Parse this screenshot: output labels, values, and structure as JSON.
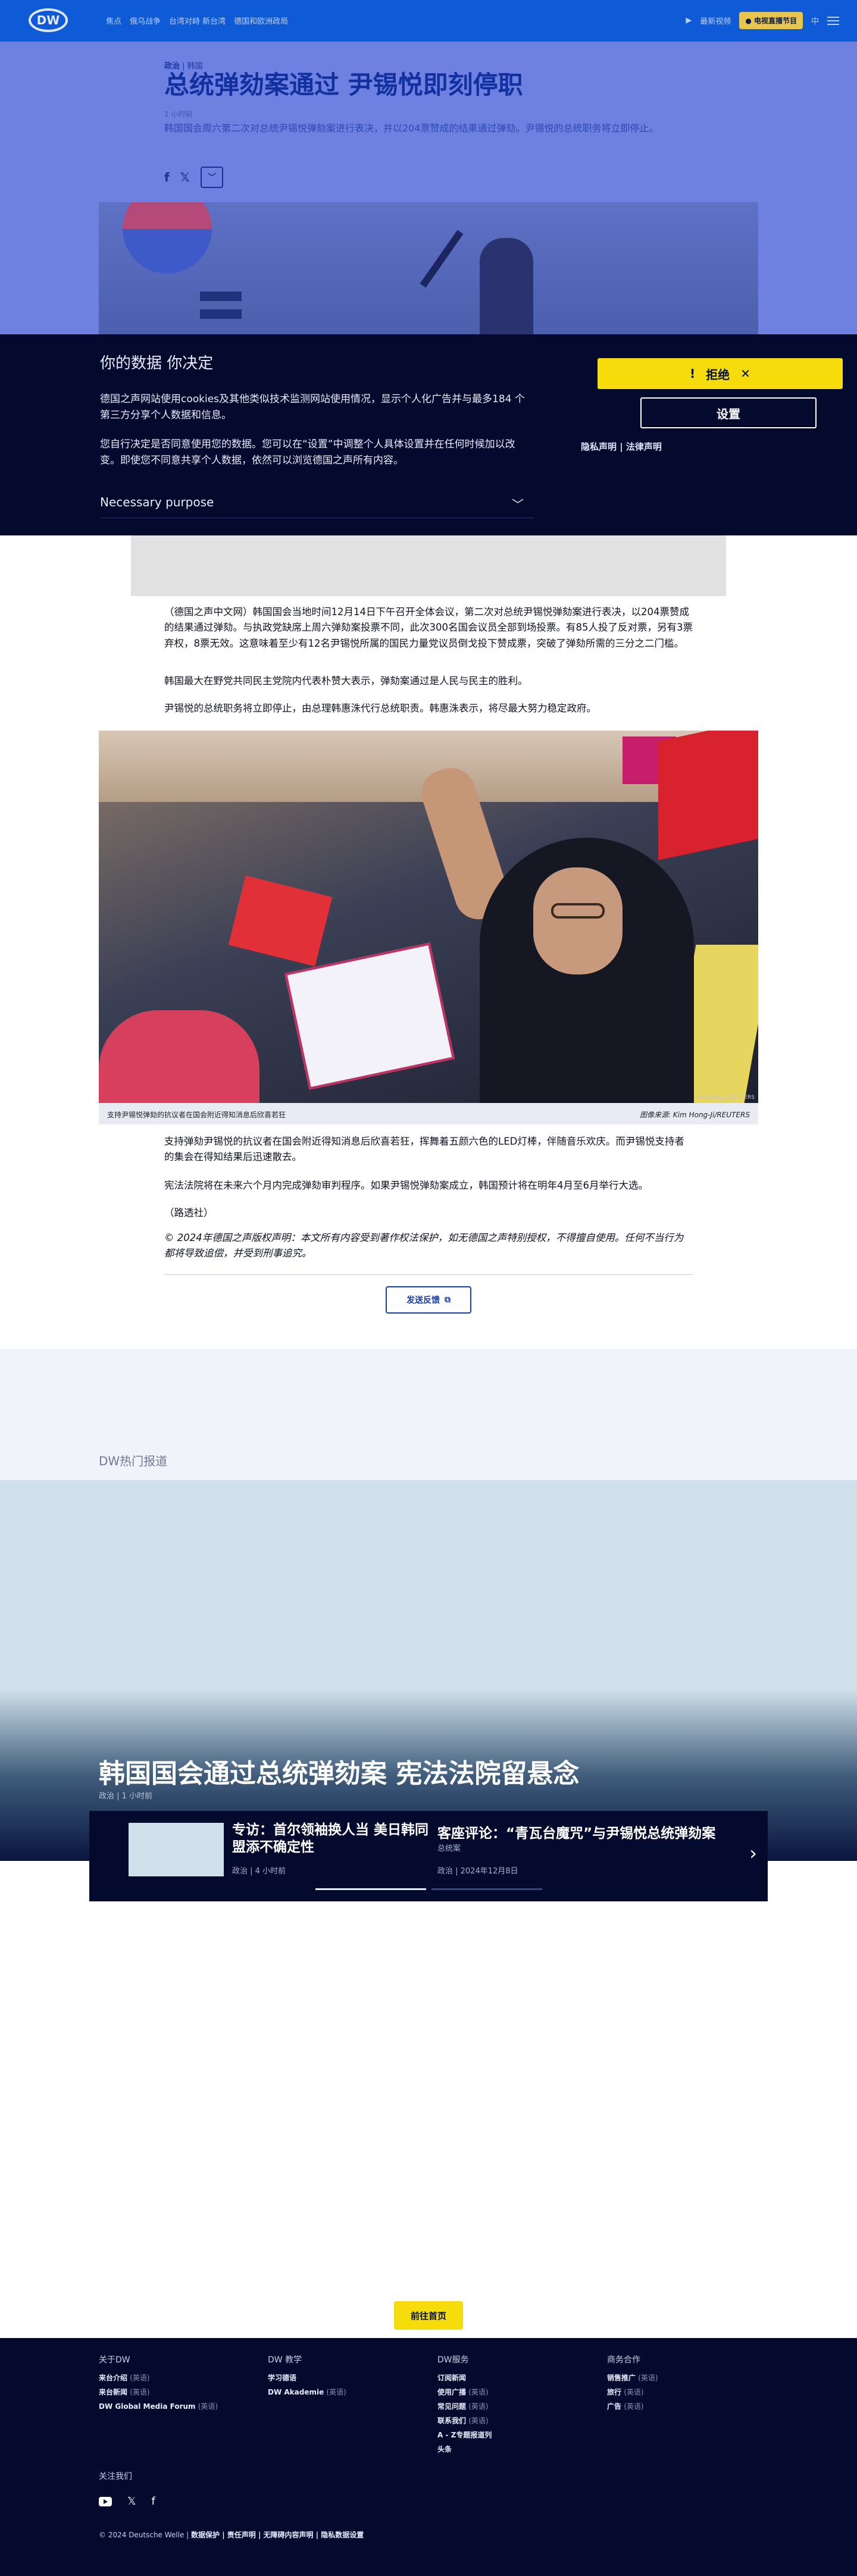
{
  "header": {
    "logo": "DW",
    "nav": [
      "焦点",
      "俄乌战争",
      "台湾对峙 新台湾",
      "德国和欧洲政局"
    ],
    "live": "最新视频",
    "live_badge": "● 电视直播节目",
    "lang": "中"
  },
  "article": {
    "category": "政治",
    "subcategory": "韩国",
    "title": "总统弹劾案通过 尹锡悦即刻停职",
    "time": "1 小时前",
    "lead": "韩国国会周六第二次对总统尹锡悦弹劾案进行表决，并以204票赞成的结果通过弹劾。尹锡悦的总统职务将立即停止。",
    "paragraphs": [
      "（德国之声中文网）韩国国会当地时间12月14日下午召开全体会议，第二次对总统尹锡悦弹劾案进行表决，以204票赞成的结果通过弹劾。与执政党缺席上周六弹劾案投票不同，此次300名国会议员全部到场投票。有85人投了反对票，另有3票弃权，8票无效。这意味着至少有12名尹锡悦所属的国民力量党议员倒戈投下赞成票，突破了弹劾所需的三分之二门槛。",
      "韩国最大在野党共同民主党院内代表朴赞大表示，弹劾案通过是人民与民主的胜利。",
      "尹锡悦的总统职务将立即停止，由总理韩惠洙代行总统职责。韩惠洙表示，将尽最大努力稳定政府。",
      "支持弹劾尹锡悦的抗议者在国会附近得知消息后欣喜若狂，挥舞着五颜六色的LED灯棒，伴随音乐欢庆。而尹锡悦支持者的集会在得知结果后迅速散去。",
      "宪法法院将在未来六个月内完成弹劾审判程序。如果尹锡悦弹劾案成立，韩国预计将在明年4月至6月举行大选。",
      "（路透社）"
    ],
    "photo_caption": "支持尹锡悦弹劾的抗议者在国会附近得知消息后欣喜若狂",
    "photo_credit": "图像来源: Kim Hong-Ji/REUTERS",
    "photo_credit_small": "Kim Hong-Ji/REUTERS",
    "copyright": "© 2024年德国之声版权声明：本文所有内容受到著作权法保护，如无德国之声特别授权，不得擅自使用。任何不当行为都将导致追偿，并受到刑事追究。",
    "feedback": "发送反馈"
  },
  "cookie": {
    "title": "你的数据 你决定",
    "p1": "德国之声网站使用cookies及其他类似技术监测网站使用情况，显示个人化广告并与最多184 个第三方分享个人数据和信息。",
    "p2": "您自行决定是否同意使用您的数据。您可以在“设置”中调整个人具体设置并在任何时候加以改变。即使您不同意共享个人数据，依然可以浏览德国之声所有内容。",
    "purpose": "Necessary purpose",
    "reject": "拒绝",
    "settings": "设置",
    "links": "隐私声明 | 法律声明"
  },
  "hot": {
    "title": "DW热门报道",
    "teaser_title": "韩国国会通过总统弹劾案 宪法法院留悬念",
    "teaser_meta": "政治 | 1 小时前",
    "items": [
      {
        "title": "专访：首尔领袖换人当 美日韩同盟添不确定性",
        "meta": "政治 | 4 小时前"
      },
      {
        "title": "客座评论：“青瓦台魔咒”与尹锡悦总统弹劾案",
        "meta": "总统案",
        "meta2": "政治 | 2024年12月8日"
      }
    ],
    "home_button": "前往首页"
  },
  "footer": {
    "cols": [
      {
        "title": "关于DW",
        "items": [
          [
            "来台介绍",
            "(英语)"
          ],
          [
            "来台新闻",
            "(英语)"
          ],
          [
            "DW Global Media Forum",
            "(英语)"
          ]
        ]
      },
      {
        "title": "DW 教学",
        "items": [
          [
            "学习德语",
            ""
          ],
          [
            "DW Akademie",
            "(英语)"
          ]
        ]
      },
      {
        "title": "DW服务",
        "items": [
          [
            "订阅新闻",
            ""
          ],
          [
            "使用广播",
            "(英语)"
          ],
          [
            "常见问题",
            "(英语)"
          ],
          [
            "联系我们",
            "(英语)"
          ],
          [
            "A - Z专题报道列",
            ""
          ],
          [
            "头条",
            ""
          ]
        ]
      },
      {
        "title": "商务合作",
        "items": [
          [
            "销售推广",
            "(英语)"
          ],
          [
            "旅行",
            "(英语)"
          ],
          [
            "广告",
            "(英语)"
          ]
        ]
      }
    ],
    "follow": "关注我们",
    "bottom": "© 2024 Deutsche Welle",
    "bottom_links": "数据保护 | 责任声明 | 无障碍内容声明 | 隐私数据设置"
  }
}
